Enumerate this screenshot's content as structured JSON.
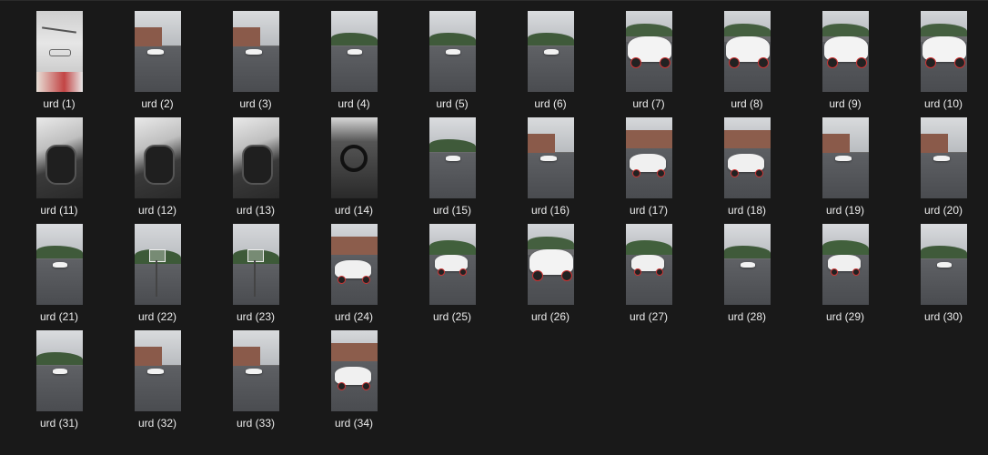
{
  "files": [
    {
      "name": "urd (1)",
      "scene": "badge"
    },
    {
      "name": "urd (2)",
      "scene": "building-car"
    },
    {
      "name": "urd (3)",
      "scene": "building-car"
    },
    {
      "name": "urd (4)",
      "scene": "trees-car"
    },
    {
      "name": "urd (5)",
      "scene": "trees-car"
    },
    {
      "name": "urd (6)",
      "scene": "trees-car"
    },
    {
      "name": "urd (7)",
      "scene": "car-close"
    },
    {
      "name": "urd (8)",
      "scene": "car-close"
    },
    {
      "name": "urd (9)",
      "scene": "car-close"
    },
    {
      "name": "urd (10)",
      "scene": "car-close"
    },
    {
      "name": "urd (11)",
      "scene": "interior"
    },
    {
      "name": "urd (12)",
      "scene": "interior"
    },
    {
      "name": "urd (13)",
      "scene": "interior"
    },
    {
      "name": "urd (14)",
      "scene": "interior-dark"
    },
    {
      "name": "urd (15)",
      "scene": "trees-car"
    },
    {
      "name": "urd (16)",
      "scene": "building-car"
    },
    {
      "name": "urd (17)",
      "scene": "building-big-car"
    },
    {
      "name": "urd (18)",
      "scene": "building-big-car"
    },
    {
      "name": "urd (19)",
      "scene": "building-car"
    },
    {
      "name": "urd (20)",
      "scene": "building-car"
    },
    {
      "name": "urd (21)",
      "scene": "trees-car"
    },
    {
      "name": "urd (22)",
      "scene": "hoop"
    },
    {
      "name": "urd (23)",
      "scene": "hoop"
    },
    {
      "name": "urd (24)",
      "scene": "building-big-car"
    },
    {
      "name": "urd (25)",
      "scene": "trees-big-car"
    },
    {
      "name": "urd (26)",
      "scene": "car-close"
    },
    {
      "name": "urd (27)",
      "scene": "trees-big-car"
    },
    {
      "name": "urd (28)",
      "scene": "trees-car"
    },
    {
      "name": "urd (29)",
      "scene": "trees-big-car"
    },
    {
      "name": "urd (30)",
      "scene": "trees-car"
    },
    {
      "name": "urd (31)",
      "scene": "trees-car"
    },
    {
      "name": "urd (32)",
      "scene": "building-car"
    },
    {
      "name": "urd (33)",
      "scene": "building-car"
    },
    {
      "name": "urd (34)",
      "scene": "building-big-car"
    }
  ],
  "colors": {
    "background": "#191919",
    "label_text": "#ececec"
  }
}
